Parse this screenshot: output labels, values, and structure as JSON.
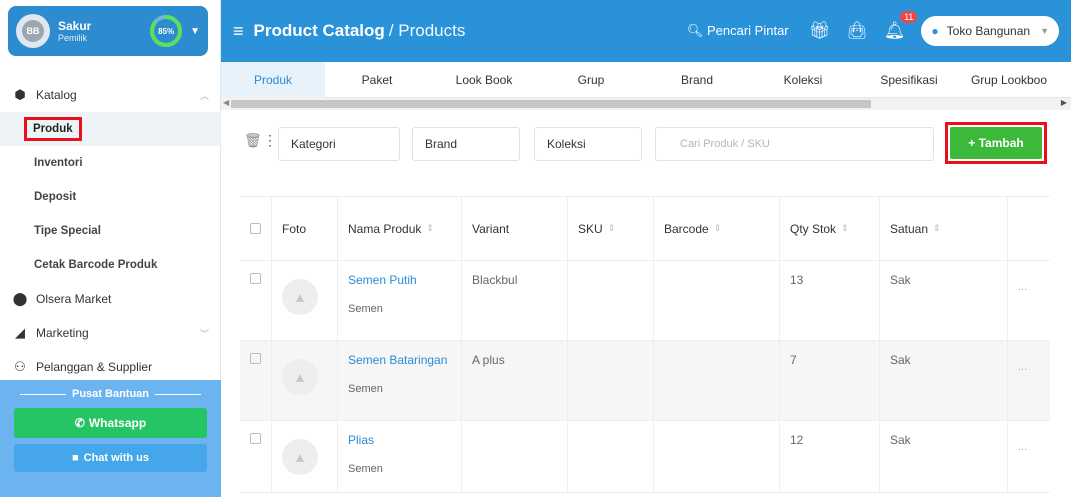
{
  "profile": {
    "initials": "BB",
    "name": "Sakur",
    "role": "Pemilik",
    "progress_label": "85%",
    "progress": 0.85
  },
  "sidebar": {
    "katalog_label": "Katalog",
    "items": [
      {
        "label": "Produk"
      },
      {
        "label": "Inventori"
      },
      {
        "label": "Deposit"
      },
      {
        "label": "Tipe Special"
      },
      {
        "label": "Cetak Barcode Produk"
      }
    ],
    "market_label": "Olsera Market",
    "marketing_label": "Marketing",
    "pelanggan_label": "Pelanggan & Supplier"
  },
  "help": {
    "title": "Pusat Bantuan",
    "whatsapp": "Whatsapp",
    "chat": "Chat with us"
  },
  "topbar": {
    "title": "Product Catalog",
    "subtitle": "/ Products",
    "search_label": "Pencari Pintar",
    "notif_count": "11",
    "store": "Toko Bangunan"
  },
  "tabs": [
    "Produk",
    "Paket",
    "Look Book",
    "Grup",
    "Brand",
    "Koleksi",
    "Spesifikasi",
    "Grup Lookboo"
  ],
  "filters": {
    "kategori": "Kategori",
    "brand": "Brand",
    "koleksi": "Koleksi",
    "search_placeholder": "Cari Produk / SKU",
    "add_label": "+ Tambah"
  },
  "table": {
    "headers": {
      "foto": "Foto",
      "nama": "Nama Produk",
      "variant": "Variant",
      "sku": "SKU",
      "barcode": "Barcode",
      "qty": "Qty Stok",
      "satuan": "Satuan"
    },
    "rows": [
      {
        "name": "Semen Putih",
        "category": "Semen",
        "variant": "Blackbul",
        "sku": "",
        "barcode": "",
        "qty": "13",
        "unit": "Sak",
        "more": "..."
      },
      {
        "name": "Semen Bataringan",
        "category": "Semen",
        "variant": "A plus",
        "sku": "",
        "barcode": "",
        "qty": "7",
        "unit": "Sak",
        "more": "..."
      },
      {
        "name": "Plias",
        "category": "Semen",
        "variant": "",
        "sku": "",
        "barcode": "",
        "qty": "12",
        "unit": "Sak",
        "more": "..."
      }
    ]
  },
  "colors": {
    "primary": "#2a92d9",
    "add_button": "#3cb83a",
    "highlight": "#e8101a",
    "whatsapp": "#25c464"
  }
}
